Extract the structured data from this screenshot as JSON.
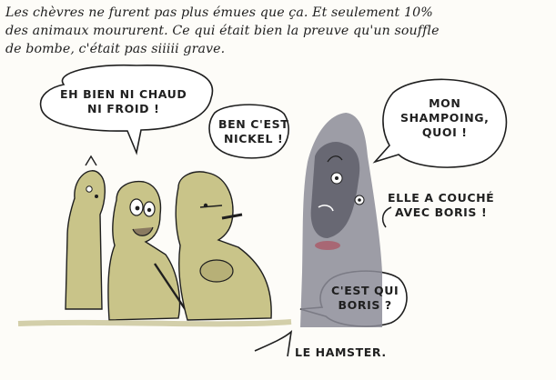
{
  "caption": {
    "line1": "Les chèvres ne furent pas plus émues que ça. Et seulement 10%",
    "line2": "des animaux moururent. Ce qui était bien la preuve qu'un souffle",
    "line3": "de bombe, c'était pas siiiii grave."
  },
  "bubbles": {
    "chaud_line1": "EH BIEN NI CHAUD",
    "chaud_line2": "NI FROID !",
    "nickel_line1": "BEN C'EST",
    "nickel_line2": "NICKEL !",
    "shampoing_line1": "MON",
    "shampoing_line2": "SHAMPOING,",
    "shampoing_line3": "QUOI !",
    "boris_line1": "ELLE A COUCHÉ",
    "boris_line2": "AVEC BORIS !",
    "quiboris_line1": "C'EST QUI",
    "quiboris_line2": "BORIS ?",
    "hamster": "LE HAMSTER."
  },
  "colors": {
    "background": "#fdfcf8",
    "ink": "#1f1f1f",
    "character_khaki": "#c9c489",
    "character_shade": "#b7b077",
    "creature_grey": "#8c8c98",
    "creature_dark": "#5b5b66",
    "blood_red": "#b03a4a"
  }
}
